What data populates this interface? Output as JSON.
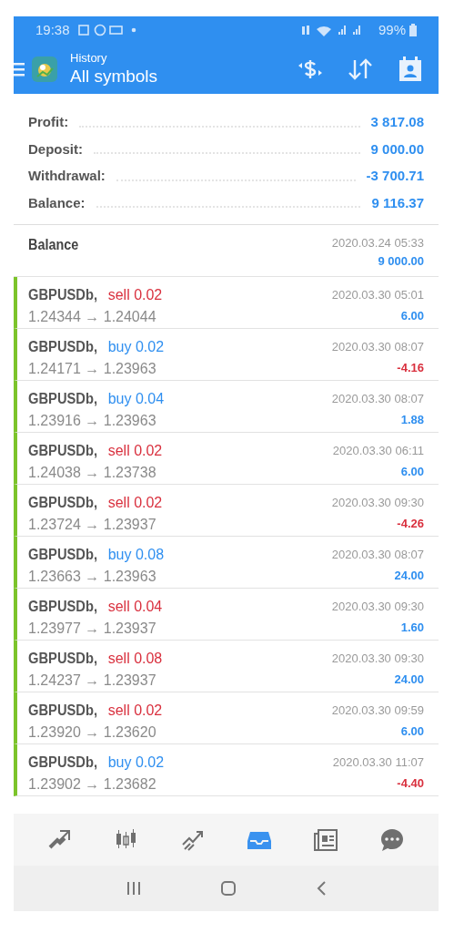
{
  "status_bar": {
    "time": "19:38",
    "battery": "99%"
  },
  "header": {
    "subtitle": "History",
    "title": "All symbols"
  },
  "summary": [
    {
      "label": "Profit:",
      "value": "3 817.08"
    },
    {
      "label": "Deposit:",
      "value": "9 000.00"
    },
    {
      "label": "Withdrawal:",
      "value": "-3 700.71"
    },
    {
      "label": "Balance:",
      "value": "9 116.37"
    }
  ],
  "balance_entry": {
    "label": "Balance",
    "time": "2020.03.24 05:33",
    "amount": "9 000.00"
  },
  "trades": [
    {
      "symbol": "GBPUSDb,",
      "kind": "sell",
      "volume": "sell 0.02",
      "prices": "1.24344 → 1.24044",
      "time": "2020.03.30 05:01",
      "profit": "6.00",
      "loss": false
    },
    {
      "symbol": "GBPUSDb,",
      "kind": "buy",
      "volume": "buy 0.02",
      "prices": "1.24171 → 1.23963",
      "time": "2020.03.30 08:07",
      "profit": "-4.16",
      "loss": true
    },
    {
      "symbol": "GBPUSDb,",
      "kind": "buy",
      "volume": "buy 0.04",
      "prices": "1.23916 → 1.23963",
      "time": "2020.03.30 08:07",
      "profit": "1.88",
      "loss": false
    },
    {
      "symbol": "GBPUSDb,",
      "kind": "sell",
      "volume": "sell 0.02",
      "prices": "1.24038 → 1.23738",
      "time": "2020.03.30 06:11",
      "profit": "6.00",
      "loss": false
    },
    {
      "symbol": "GBPUSDb,",
      "kind": "sell",
      "volume": "sell 0.02",
      "prices": "1.23724 → 1.23937",
      "time": "2020.03.30 09:30",
      "profit": "-4.26",
      "loss": true
    },
    {
      "symbol": "GBPUSDb,",
      "kind": "buy",
      "volume": "buy 0.08",
      "prices": "1.23663 → 1.23963",
      "time": "2020.03.30 08:07",
      "profit": "24.00",
      "loss": false
    },
    {
      "symbol": "GBPUSDb,",
      "kind": "sell",
      "volume": "sell 0.04",
      "prices": "1.23977 → 1.23937",
      "time": "2020.03.30 09:30",
      "profit": "1.60",
      "loss": false
    },
    {
      "symbol": "GBPUSDb,",
      "kind": "sell",
      "volume": "sell 0.08",
      "prices": "1.24237 → 1.23937",
      "time": "2020.03.30 09:30",
      "profit": "24.00",
      "loss": false
    },
    {
      "symbol": "GBPUSDb,",
      "kind": "sell",
      "volume": "sell 0.02",
      "prices": "1.23920 → 1.23620",
      "time": "2020.03.30 09:59",
      "profit": "6.00",
      "loss": false
    },
    {
      "symbol": "GBPUSDb,",
      "kind": "buy",
      "volume": "buy 0.02",
      "prices": "1.23902 → 1.23682",
      "time": "2020.03.30 11:07",
      "profit": "-4.40",
      "loss": true
    }
  ],
  "bottom_nav": [
    {
      "kind": "quotes",
      "selected": false
    },
    {
      "kind": "chart",
      "selected": false
    },
    {
      "kind": "trade",
      "selected": false
    },
    {
      "kind": "history",
      "selected": true
    },
    {
      "kind": "news",
      "selected": false
    },
    {
      "kind": "chat",
      "selected": false
    }
  ]
}
